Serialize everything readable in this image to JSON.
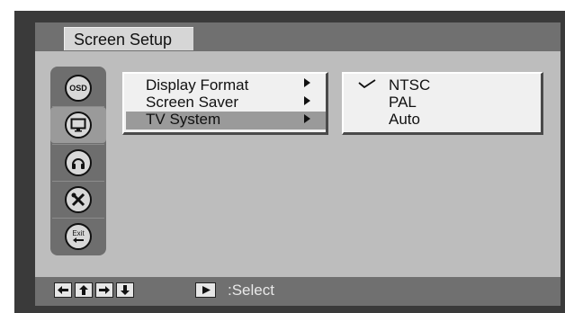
{
  "header": {
    "title": "Screen Setup"
  },
  "sidebar": {
    "icons": [
      {
        "name": "osd-icon",
        "label": "OSD",
        "selected": false
      },
      {
        "name": "monitor-icon",
        "selected": true
      },
      {
        "name": "headphones-icon",
        "selected": false
      },
      {
        "name": "tools-icon",
        "selected": false
      },
      {
        "name": "exit-icon",
        "label": "Exit",
        "selected": false
      }
    ]
  },
  "menu": {
    "items": [
      {
        "label": "Display Format",
        "highlighted": false
      },
      {
        "label": "Screen Saver",
        "highlighted": false
      },
      {
        "label": "TV System",
        "highlighted": true
      }
    ]
  },
  "submenu": {
    "options": [
      {
        "label": "NTSC",
        "checked": true
      },
      {
        "label": "PAL",
        "checked": false
      },
      {
        "label": "Auto",
        "checked": false
      }
    ]
  },
  "footer": {
    "nav_keys": [
      "left-arrow-icon",
      "up-arrow-icon",
      "right-arrow-icon",
      "down-arrow-icon"
    ],
    "play_key": "play-icon",
    "select_label": ":Select"
  },
  "colors": {
    "frame": "#3a3a3a",
    "panel": "#bdbdbd",
    "bars": "#707070",
    "highlight": "#9a9a9a",
    "menu_bg": "#f0f0f0"
  }
}
